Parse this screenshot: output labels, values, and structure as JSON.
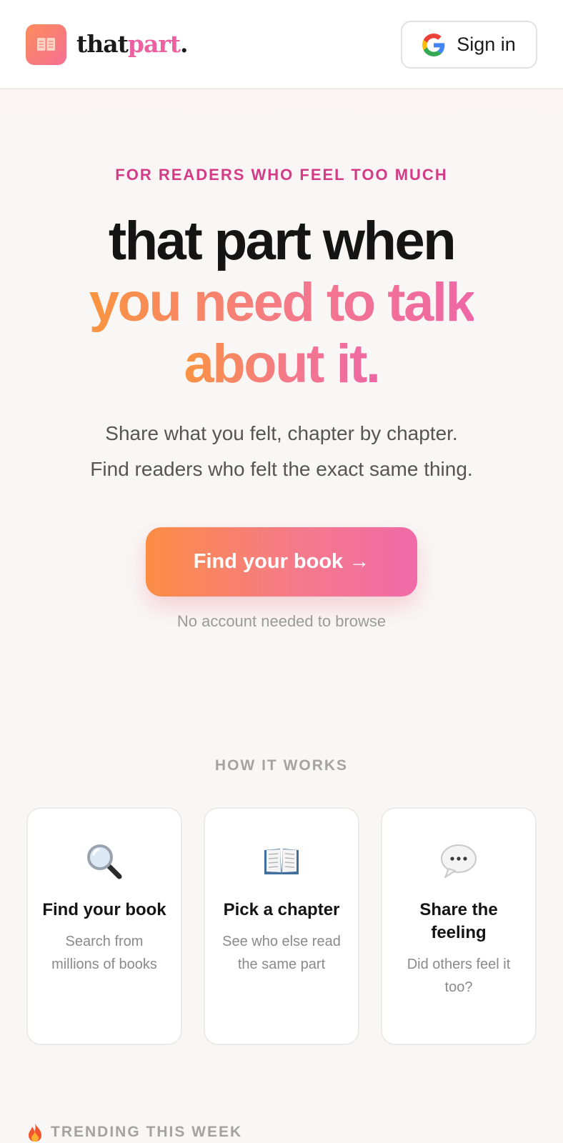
{
  "header": {
    "brand_part1": "that",
    "brand_part2": "part",
    "brand_part3": ".",
    "signin_label": "Sign in"
  },
  "hero": {
    "eyebrow": "FOR READERS WHO FEEL TOO MUCH",
    "headline_line1": "that part when",
    "headline_line2": "you need to talk",
    "headline_line3": "about it.",
    "sub_line1": "Share what you felt, chapter by chapter.",
    "sub_line2": "Find readers who felt the exact same thing.",
    "cta_label": "Find your book →",
    "note": "No account needed to browse"
  },
  "how_it_works": {
    "title": "HOW IT WORKS",
    "steps": [
      {
        "icon": "magnifying-glass-icon",
        "title": "Find your book",
        "desc": "Search from millions of books"
      },
      {
        "icon": "open-book-icon",
        "title": "Pick a chapter",
        "desc": "See who else read the same part"
      },
      {
        "icon": "speech-bubble-icon",
        "title": "Share the feeling",
        "desc": "Did others feel it too?"
      }
    ]
  },
  "trending": {
    "icon": "fire-icon",
    "title": "TRENDING THIS WEEK"
  },
  "colors": {
    "accent_pink": "#ec5fa0",
    "accent_orange": "#fa9440",
    "eyebrow": "#d43b86"
  }
}
